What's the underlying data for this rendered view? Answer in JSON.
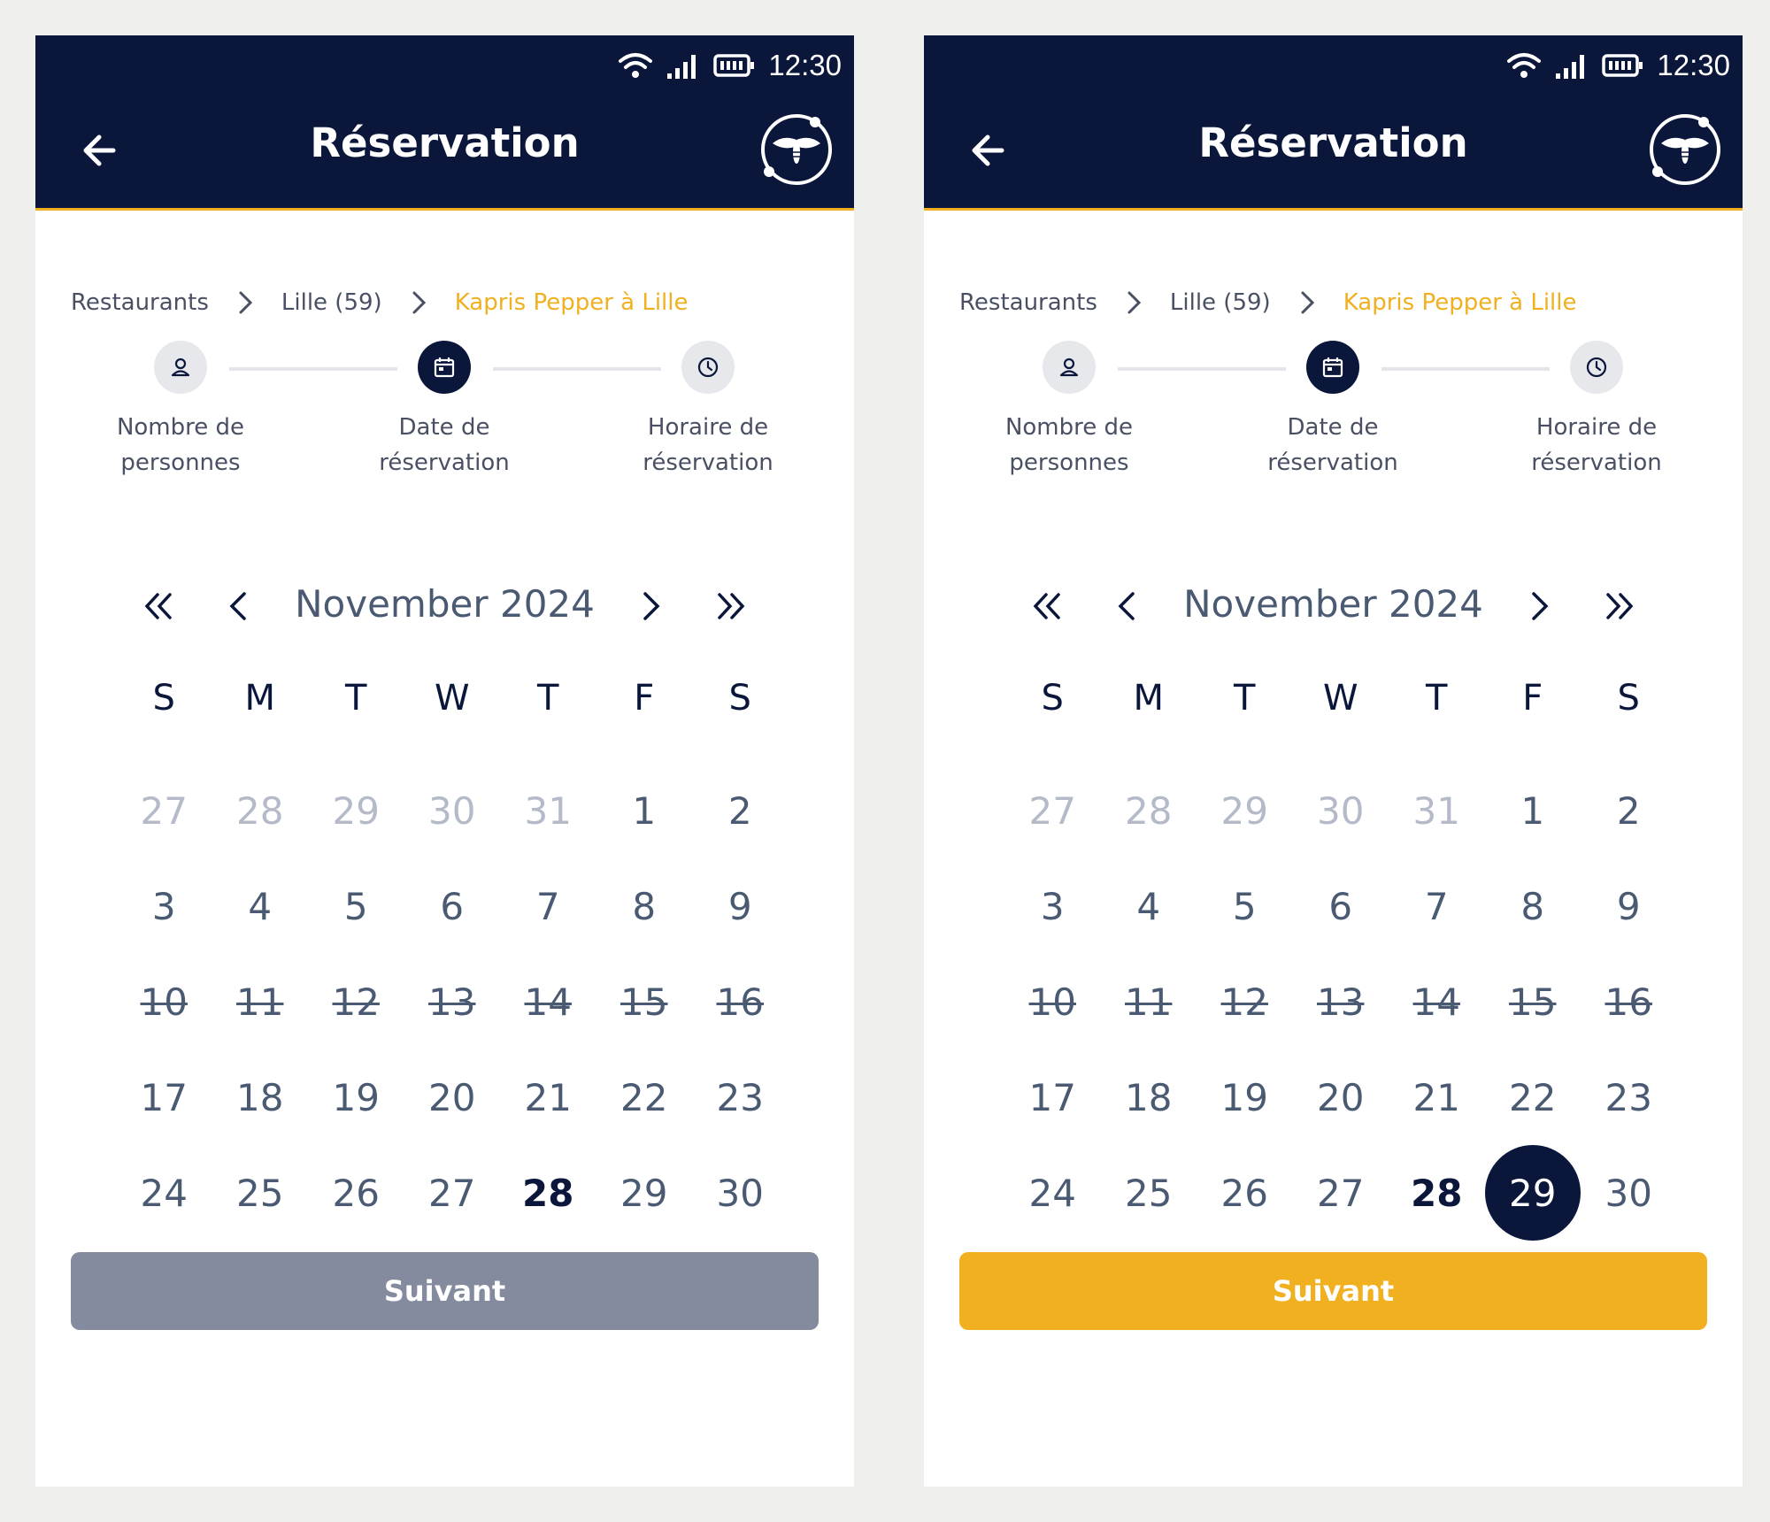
{
  "colors": {
    "navy": "#0b163b",
    "accent": "#f0b020",
    "disabled": "#858b9e"
  },
  "status": {
    "time": "12:30"
  },
  "header": {
    "title": "Réservation"
  },
  "breadcrumb": [
    {
      "label": "Restaurants"
    },
    {
      "label": "Lille (59)"
    },
    {
      "label": "Kapris Pepper à Lille"
    }
  ],
  "steps": [
    {
      "line1": "Nombre de",
      "line2": "personnes",
      "icon": "person-icon"
    },
    {
      "line1": "Date de",
      "line2": "réservation",
      "icon": "calendar-icon"
    },
    {
      "line1": "Horaire de",
      "line2": "réservation",
      "icon": "clock-icon"
    }
  ],
  "calendar": {
    "month": "November 2024",
    "weekdays": [
      "S",
      "M",
      "T",
      "W",
      "T",
      "F",
      "S"
    ],
    "weeks": [
      [
        "27",
        "28",
        "29",
        "30",
        "31",
        "1",
        "2"
      ],
      [
        "3",
        "4",
        "5",
        "6",
        "7",
        "8",
        "9"
      ],
      [
        "10",
        "11",
        "12",
        "13",
        "14",
        "15",
        "16"
      ],
      [
        "17",
        "18",
        "19",
        "20",
        "21",
        "22",
        "23"
      ],
      [
        "24",
        "25",
        "26",
        "27",
        "28",
        "29",
        "30"
      ]
    ]
  },
  "button": {
    "label": "Suivant"
  }
}
